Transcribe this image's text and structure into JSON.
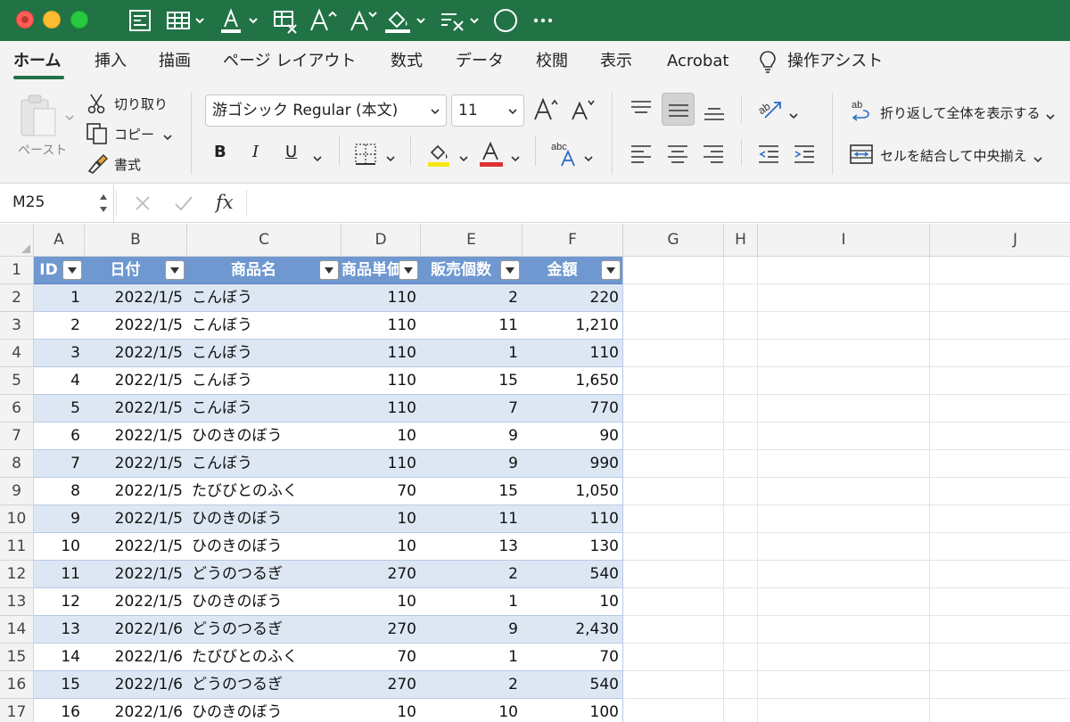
{
  "menu": {
    "tabs": [
      "ホーム",
      "挿入",
      "描画",
      "ページ レイアウト",
      "数式",
      "データ",
      "校閲",
      "表示",
      "Acrobat",
      "操作アシスト"
    ]
  },
  "ribbon": {
    "paste_label": "ペースト",
    "cut_label": "切り取り",
    "copy_label": "コピー",
    "format_painter_label": "書式",
    "font_name": "游ゴシック Regular (本文)",
    "font_size": "11",
    "bold": "B",
    "italic": "I",
    "underline": "U",
    "wrap_text_label": "折り返して全体を表示する",
    "merge_center_label": "セルを結合して中央揃え"
  },
  "formula_bar": {
    "name_box": "M25",
    "fx_label": "fx",
    "formula": ""
  },
  "sheet": {
    "columns": [
      "A",
      "B",
      "C",
      "D",
      "E",
      "F",
      "G",
      "H",
      "I",
      "J"
    ],
    "row_numbers": [
      "1",
      "2",
      "3",
      "4",
      "5",
      "6",
      "7",
      "8",
      "9",
      "10",
      "11",
      "12",
      "13",
      "14",
      "15",
      "16",
      "17"
    ],
    "table_headers": [
      "ID",
      "日付",
      "商品名",
      "商品単価",
      "販売個数",
      "金額"
    ],
    "rows": [
      [
        "1",
        "2022/1/5",
        "こんぼう",
        "110",
        "2",
        "220"
      ],
      [
        "2",
        "2022/1/5",
        "こんぼう",
        "110",
        "11",
        "1,210"
      ],
      [
        "3",
        "2022/1/5",
        "こんぼう",
        "110",
        "1",
        "110"
      ],
      [
        "4",
        "2022/1/5",
        "こんぼう",
        "110",
        "15",
        "1,650"
      ],
      [
        "5",
        "2022/1/5",
        "こんぼう",
        "110",
        "7",
        "770"
      ],
      [
        "6",
        "2022/1/5",
        "ひのきのぼう",
        "10",
        "9",
        "90"
      ],
      [
        "7",
        "2022/1/5",
        "こんぼう",
        "110",
        "9",
        "990"
      ],
      [
        "8",
        "2022/1/5",
        "たびびとのふく",
        "70",
        "15",
        "1,050"
      ],
      [
        "9",
        "2022/1/5",
        "ひのきのぼう",
        "10",
        "11",
        "110"
      ],
      [
        "10",
        "2022/1/5",
        "ひのきのぼう",
        "10",
        "13",
        "130"
      ],
      [
        "11",
        "2022/1/5",
        "どうのつるぎ",
        "270",
        "2",
        "540"
      ],
      [
        "12",
        "2022/1/5",
        "ひのきのぼう",
        "10",
        "1",
        "10"
      ],
      [
        "13",
        "2022/1/6",
        "どうのつるぎ",
        "270",
        "9",
        "2,430"
      ],
      [
        "14",
        "2022/1/6",
        "たびびとのふく",
        "70",
        "1",
        "70"
      ],
      [
        "15",
        "2022/1/6",
        "どうのつるぎ",
        "270",
        "2",
        "540"
      ],
      [
        "16",
        "2022/1/6",
        "ひのきのぼう",
        "10",
        "10",
        "100"
      ]
    ]
  },
  "colors": {
    "titlebar": "#217346",
    "table_header": "#6f98d0",
    "table_band": "#dde7f4"
  },
  "icons": [
    "close-window-icon",
    "minimize-window-icon",
    "zoom-window-icon",
    "scissors-icon",
    "copy-icon",
    "format-painter-icon",
    "fill-color-icon",
    "font-color-icon",
    "wrap-text-icon",
    "merge-cells-icon",
    "lightbulb-icon"
  ]
}
